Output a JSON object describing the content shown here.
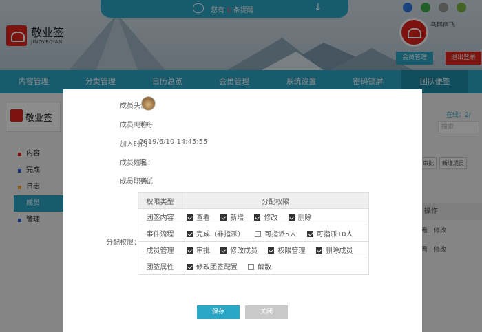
{
  "header": {
    "notice_prefix": "您有",
    "notice_count": "0",
    "notice_suffix": "条提醒",
    "logo_cn": "敬业签",
    "logo_en": "JINGYEQIAN",
    "username": "乌鹊南飞",
    "member_button": "会员管理",
    "logout_button": "退出登录",
    "os_icons": [
      "ie-icon",
      "windows-icon",
      "apple-icon",
      "android-icon"
    ]
  },
  "nav": {
    "items": [
      "内容管理",
      "分类管理",
      "日历总览",
      "会员管理",
      "系统设置",
      "密码锁屏",
      "团队便签"
    ],
    "active": "团队便签"
  },
  "background": {
    "brand": "敬业签",
    "online": "在线：2/",
    "search_placeholder": "搜索",
    "sidebar": [
      {
        "label": "内容",
        "color": "#e2231a"
      },
      {
        "label": "完成",
        "color": "#2a62d6"
      },
      {
        "label": "日志",
        "color": "#f0a020"
      },
      {
        "label": "成员",
        "color": "#2aa7c6"
      },
      {
        "label": "管理",
        "color": "#2a62d6"
      }
    ],
    "right_buttons": [
      "审批",
      "新增成员"
    ],
    "op_header": "操作",
    "op_rows": [
      {
        "a": "看",
        "b": "修改"
      },
      {
        "a": "看",
        "b": "修改"
      }
    ]
  },
  "modal": {
    "avatar_label": "成员头像：",
    "nickname_label": "成员昵称：",
    "nickname": "同舟",
    "join_label": "加入时间：",
    "join_time": "2019/6/10 14:45:55",
    "name_label": "成员姓名：",
    "name": "珉",
    "role_label": "成员职务：",
    "role": "测试",
    "perm_label": "分配权限：",
    "perm_header_type": "权限类型",
    "perm_header_assign": "分配权限",
    "permissions": [
      {
        "type": "团签内容",
        "options": [
          {
            "label": "查看",
            "checked": true
          },
          {
            "label": "新增",
            "checked": true
          },
          {
            "label": "修改",
            "checked": true
          },
          {
            "label": "删除",
            "checked": true
          }
        ]
      },
      {
        "type": "事件流程",
        "options": [
          {
            "label": "完成（非指派）",
            "checked": true
          },
          {
            "label": "可指派5人",
            "checked": false
          },
          {
            "label": "可指派10人",
            "checked": true
          }
        ]
      },
      {
        "type": "成员管理",
        "options": [
          {
            "label": "审批",
            "checked": true
          },
          {
            "label": "修改成员",
            "checked": true
          },
          {
            "label": "权限管理",
            "checked": true
          },
          {
            "label": "删除成员",
            "checked": true
          }
        ]
      },
      {
        "type": "团签属性",
        "options": [
          {
            "label": "修改团签配置",
            "checked": true
          },
          {
            "label": "解散",
            "checked": false
          }
        ]
      }
    ],
    "save_button": "保存",
    "close_button": "关闭"
  },
  "colors": {
    "accent": "#2aa7c6",
    "brand_red": "#e2231a"
  }
}
